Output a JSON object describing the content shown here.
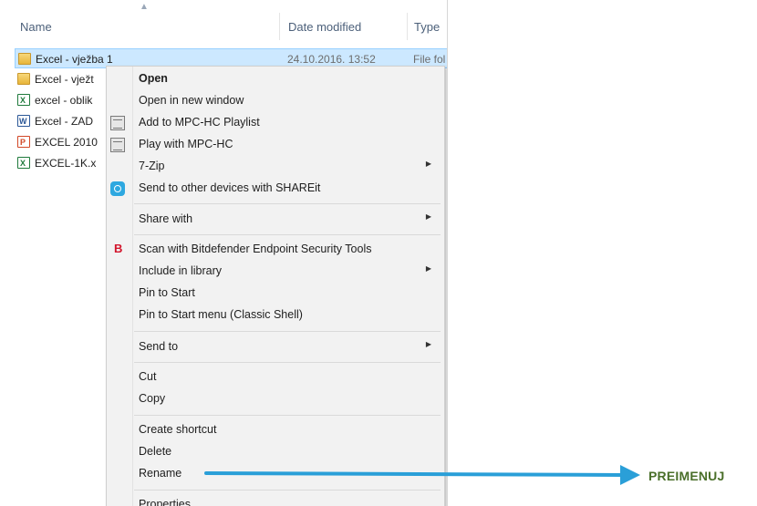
{
  "explorer": {
    "columns": {
      "name": "Name",
      "date": "Date modified",
      "type": "Type"
    },
    "files": [
      {
        "name": "Excel - vježba 1",
        "date": "24.10.2016. 13:52",
        "type": "File fol",
        "icon": "folder-icon"
      },
      {
        "name": "Excel - vježt",
        "date": "",
        "type": "",
        "icon": "folder-icon"
      },
      {
        "name": "excel - oblik",
        "date": "",
        "type": "",
        "icon": "excel-file-icon"
      },
      {
        "name": "Excel - ZAD",
        "date": "",
        "type": "",
        "icon": "word-file-icon"
      },
      {
        "name": "EXCEL 2010",
        "date": "",
        "type": "",
        "icon": "powerpoint-file-icon"
      },
      {
        "name": "EXCEL-1K.x",
        "date": "",
        "type": "",
        "icon": "excel-file-icon"
      }
    ]
  },
  "context_menu": {
    "items": [
      {
        "label": "Open",
        "bold": true
      },
      {
        "label": "Open in new window"
      },
      {
        "label": "Add to MPC-HC Playlist",
        "icon": "mpc-hc-icon"
      },
      {
        "label": "Play with MPC-HC",
        "icon": "mpc-hc-icon"
      },
      {
        "label": "7-Zip",
        "submenu": true
      },
      {
        "label": "Send to other devices with SHAREit",
        "icon": "shareit-icon"
      },
      {
        "label": "Share with",
        "submenu": true
      },
      {
        "label": "Scan with Bitdefender Endpoint Security Tools",
        "icon": "bitdefender-icon",
        "icon_glyph": "B"
      },
      {
        "label": "Include in library",
        "submenu": true
      },
      {
        "label": "Pin to Start"
      },
      {
        "label": "Pin to Start menu (Classic Shell)"
      },
      {
        "label": "Send to",
        "submenu": true
      },
      {
        "label": "Cut"
      },
      {
        "label": "Copy"
      },
      {
        "label": "Create shortcut"
      },
      {
        "label": "Delete"
      },
      {
        "label": "Rename"
      },
      {
        "label": "Properties"
      }
    ]
  },
  "annotation": {
    "label": "PREIMENUJ",
    "arrow_color": "#2a9fd8",
    "label_color": "#4a6f2a"
  }
}
